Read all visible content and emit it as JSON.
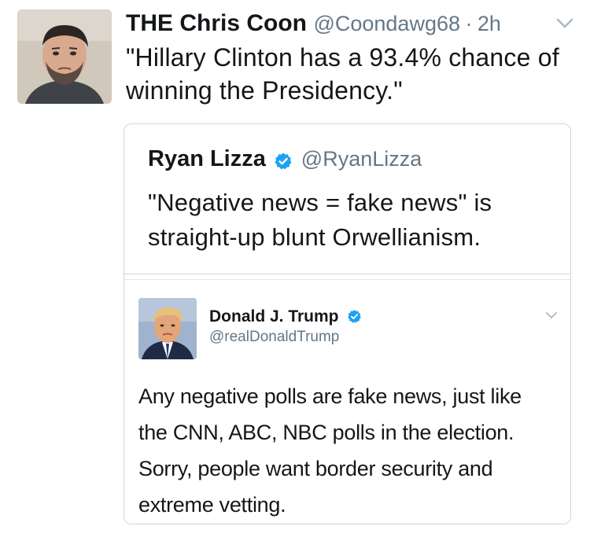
{
  "tweet": {
    "author": {
      "display_name": "THE Chris Coon",
      "handle": "@Coondawg68",
      "avatar_icon": "profile-photo-man-with-beard"
    },
    "separator": "·",
    "time": "2h",
    "text": "\"Hillary Clinton has a 93.4% chance of winning the Presidency.\"",
    "menu_icon": "chevron-down-icon"
  },
  "quote": {
    "author": {
      "display_name": "Ryan Lizza",
      "handle": "@RyanLizza",
      "verified": true
    },
    "text": "\"Negative news = fake news\" is straight-up blunt Orwellianism.",
    "embedded": {
      "author": {
        "display_name": "Donald J. Trump",
        "handle": "@realDonaldTrump",
        "verified": true,
        "avatar_icon": "profile-photo-man-in-suit"
      },
      "text": "Any negative polls are fake news, just like the CNN, ABC, NBC polls in the election. Sorry, people want border security and extreme vetting.",
      "menu_icon": "chevron-down-icon"
    }
  },
  "colors": {
    "text_primary": "#14171a",
    "text_secondary": "#657786",
    "border": "#ccd6dd",
    "verified_blue": "#1da1f2"
  }
}
